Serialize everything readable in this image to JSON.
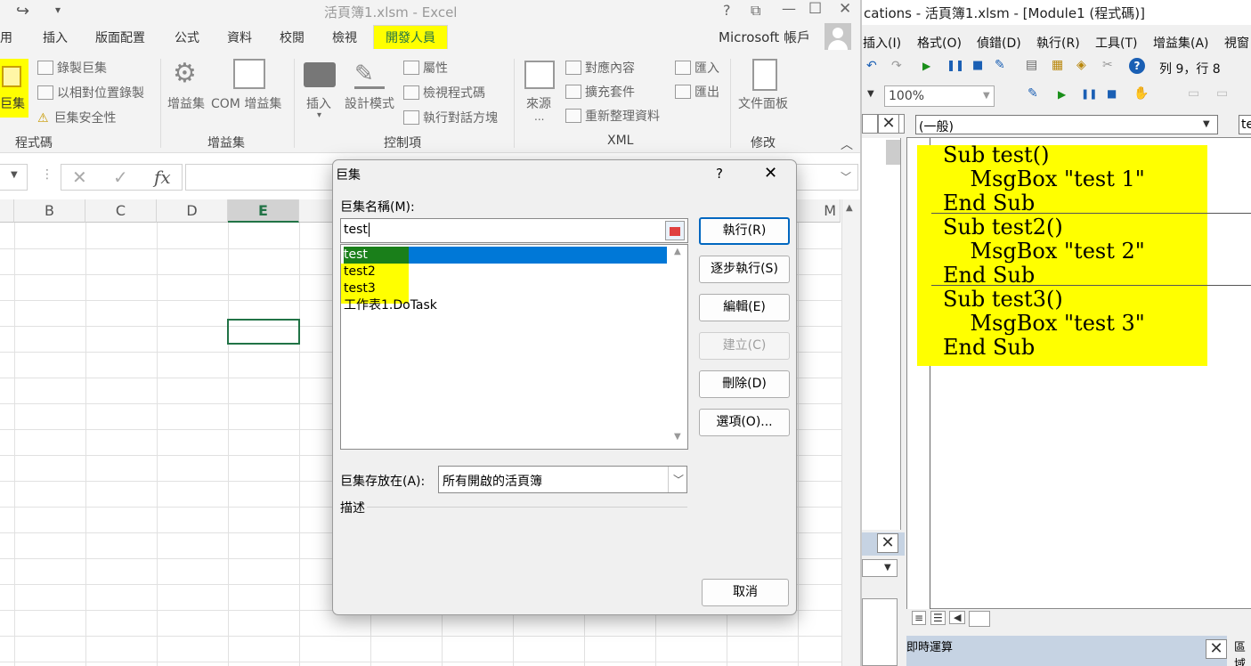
{
  "excel": {
    "title": "活頁簿1.xlsm - Excel",
    "quick_access": [
      "↪",
      "▾"
    ],
    "window_controls": [
      "?",
      "⧉",
      "—",
      "☐",
      "✕"
    ],
    "tabs": [
      "用",
      "插入",
      "版面配置",
      "公式",
      "資料",
      "校閱",
      "檢視",
      "開發人員"
    ],
    "active_tab": "開發人員",
    "account": "Microsoft 帳戶",
    "ribbon": {
      "code_group": {
        "big": "巨集",
        "record": "錄製巨集",
        "relative": "以相對位置錄製",
        "security": "巨集安全性",
        "label": "程式碼"
      },
      "addins_group": {
        "addins": "增益集",
        "com": "COM 增益集",
        "label": "增益集"
      },
      "controls_group": {
        "insert": "插入",
        "design": "設計模式",
        "properties": "屬性",
        "view_code": "檢視程式碼",
        "run_dialog": "執行對話方塊",
        "label": "控制項"
      },
      "xml_group": {
        "source": "來源",
        "source_sub": "...",
        "map": "對應內容",
        "expansion": "擴充套件",
        "refresh": "重新整理資料",
        "import": "匯入",
        "export": "匯出",
        "label": "XML"
      },
      "modify_group": {
        "doc_panel": "文件面板",
        "label": "修改"
      }
    },
    "formula_bar": {
      "cancel": "✕",
      "enter": "✓",
      "fx": "fx",
      "value": ""
    },
    "columns": [
      "B",
      "C",
      "D",
      "E",
      "M"
    ],
    "selected_column": "E"
  },
  "vbe": {
    "title": "cations - 活頁簿1.xlsm - [Module1 (程式碼)]",
    "menu": [
      "插入(I)",
      "格式(O)",
      "偵錯(D)",
      "執行(R)",
      "工具(T)",
      "增益集(A)",
      "視窗"
    ],
    "position": "列 9，行 8",
    "zoom": "100%",
    "object_dropdown": "(一般)",
    "proc_dropdown": "te",
    "code_lines": [
      "Sub test()",
      "    MsgBox \"test 1\"",
      "End Sub",
      "Sub test2()",
      "    MsgBox \"test 2\"",
      "End Sub",
      "Sub test3()",
      "    MsgBox \"test 3\"",
      "End Sub"
    ],
    "immediate_title": "即時運算",
    "locals_title": "區域"
  },
  "dialog": {
    "title": "巨集",
    "help": "?",
    "close": "✕",
    "name_label": "巨集名稱(M):",
    "name_value": "test",
    "macros": [
      "test",
      "test2",
      "test3",
      "工作表1.DoTask"
    ],
    "buttons": {
      "run": "執行(R)",
      "step": "逐步執行(S)",
      "edit": "編輯(E)",
      "create": "建立(C)",
      "delete": "刪除(D)",
      "options": "選項(O)...",
      "cancel": "取消"
    },
    "store_label": "巨集存放在(A):",
    "store_value": "所有開啟的活頁簿",
    "desc_label": "描述"
  },
  "colors": {
    "highlight": "#ffff00",
    "selection": "#0078d7",
    "excel_green": "#217346"
  }
}
